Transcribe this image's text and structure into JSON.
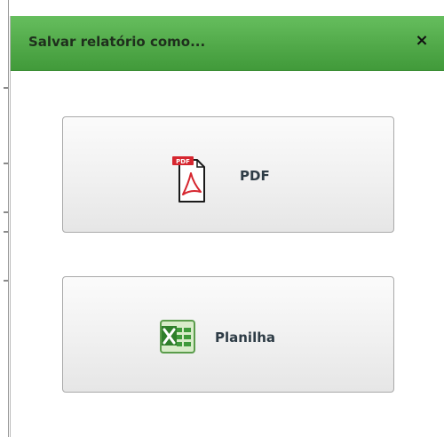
{
  "dialog": {
    "title": "Salvar relatório como...",
    "close_label": "×"
  },
  "options": {
    "pdf": {
      "label": "PDF",
      "icon": "pdf-file-icon",
      "badge": "PDF"
    },
    "spreadsheet": {
      "label": "Planilha",
      "icon": "excel-spreadsheet-icon"
    }
  },
  "colors": {
    "titlebar": "#53ab4b",
    "title_text": "#1f2f1d",
    "button_text": "#2e3c46",
    "pdf_red": "#d6262f",
    "excel_green": "#3e9a3a"
  }
}
